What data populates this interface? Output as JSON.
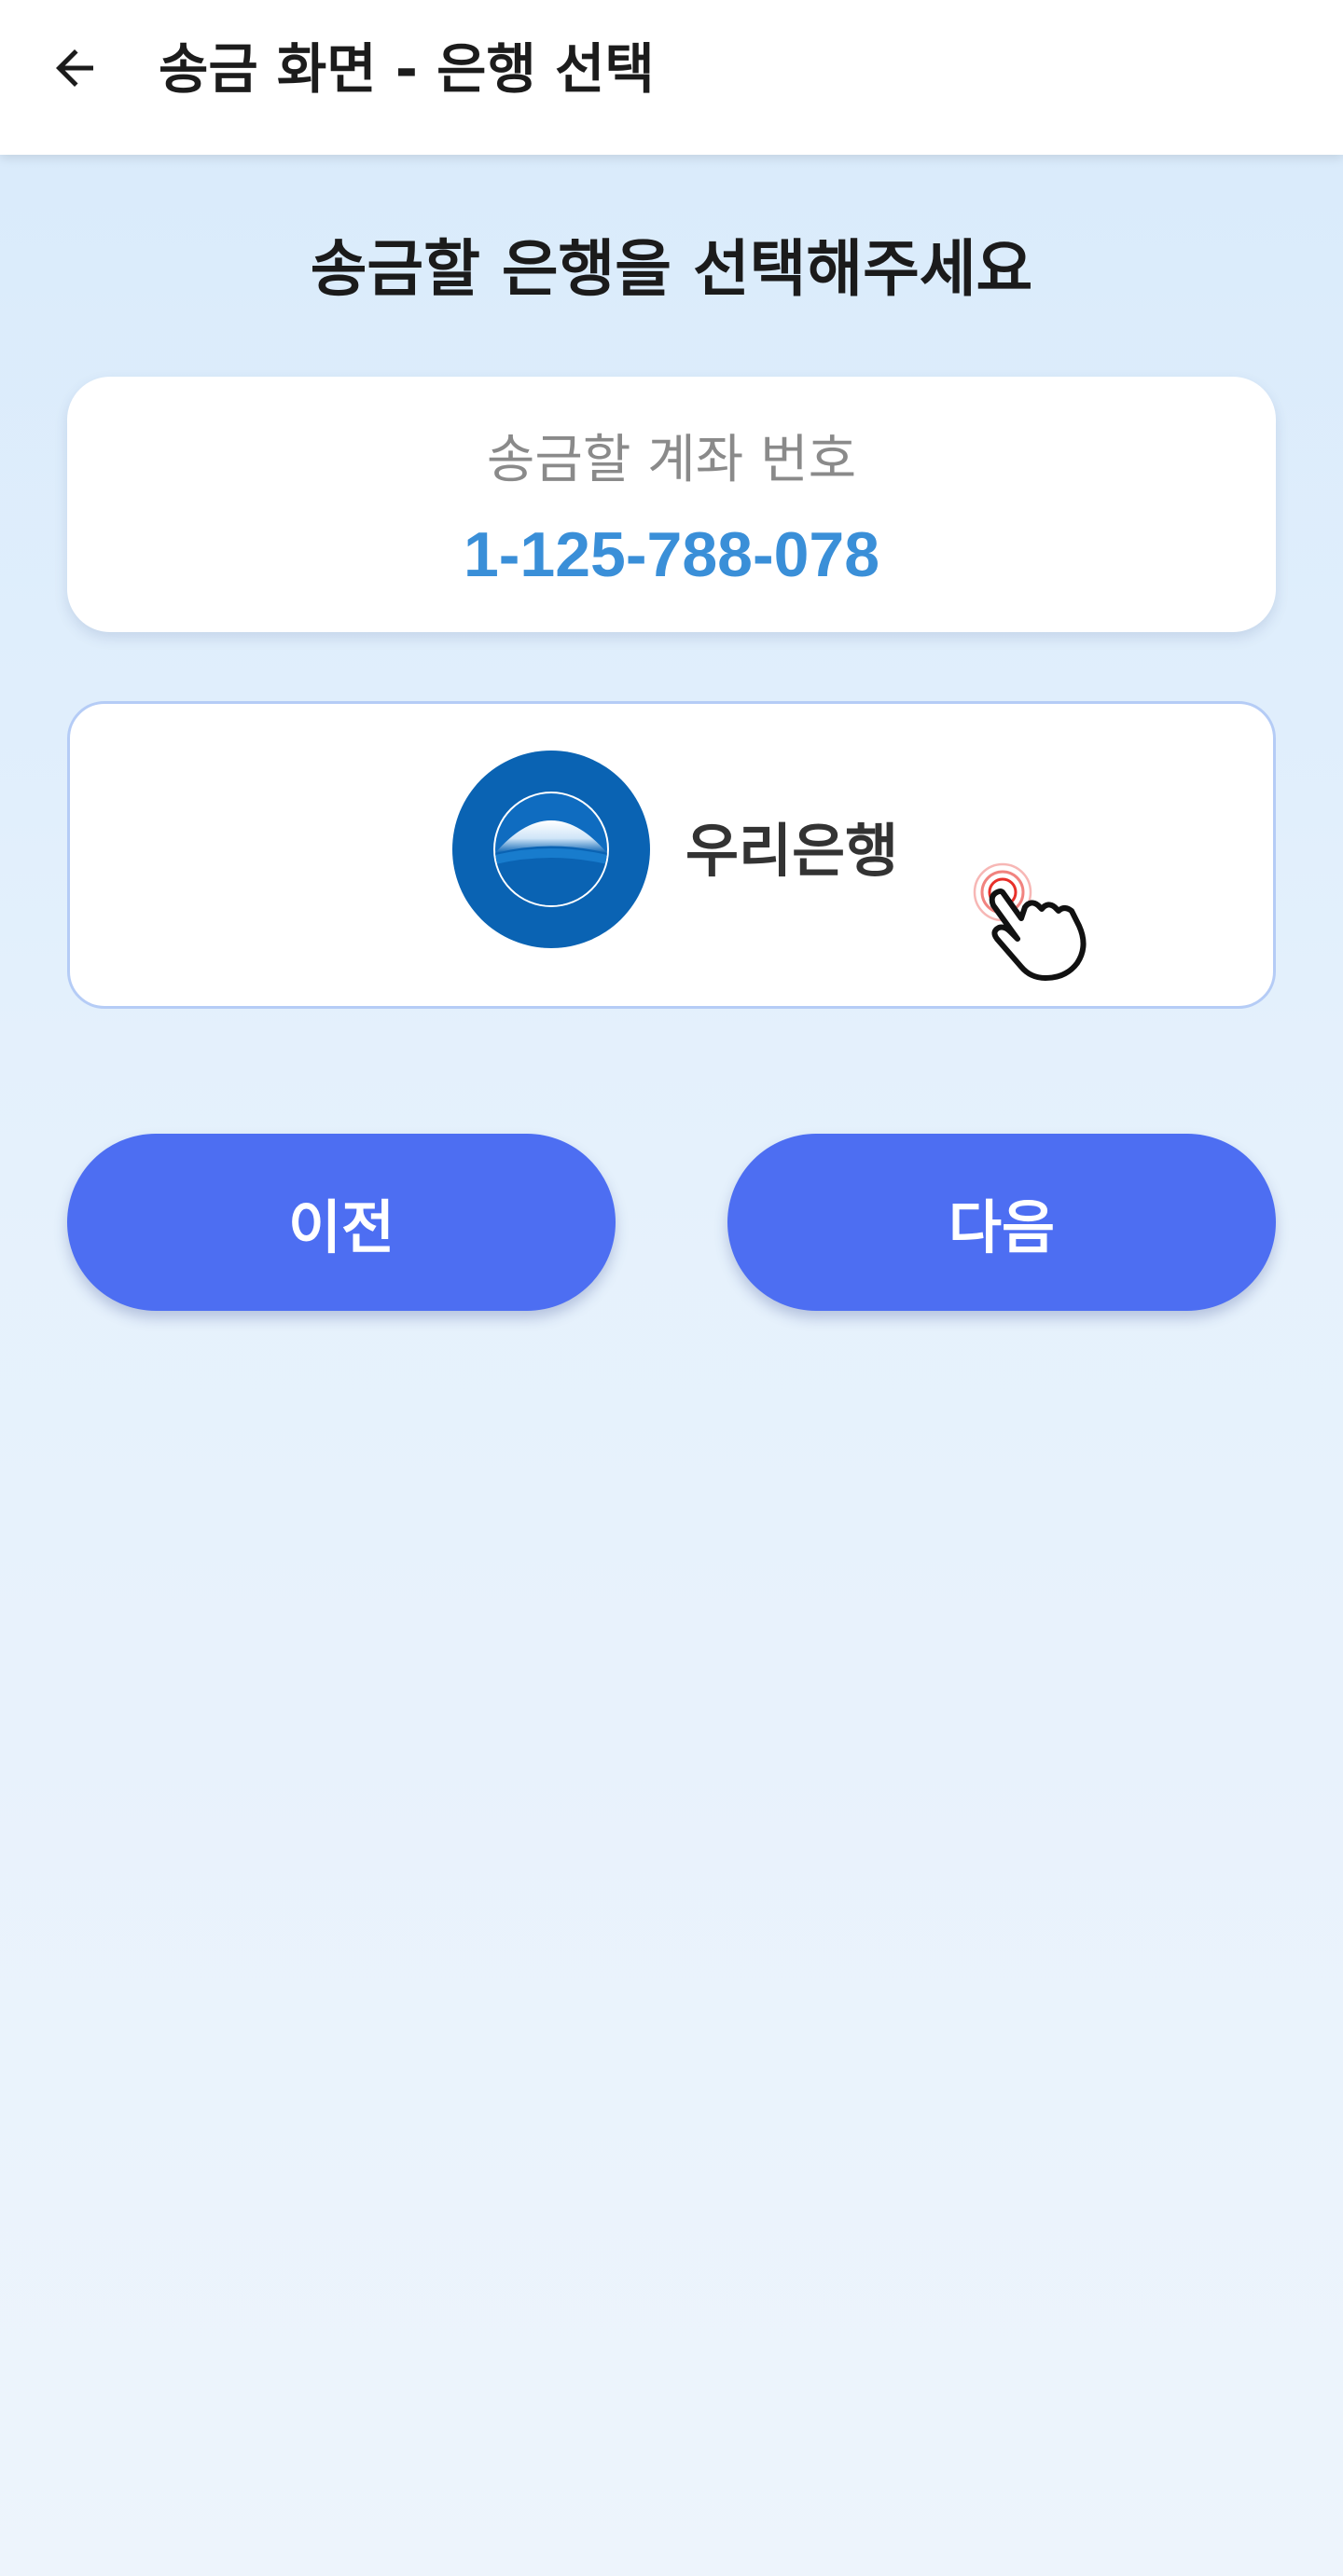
{
  "app_bar": {
    "back_icon": "arrow-left-icon",
    "title": "송금 화면 - 은행 선택"
  },
  "main": {
    "heading": "송금할 은행을 선택해주세요",
    "account": {
      "label": "송금할 계좌 번호",
      "number": "1-125-788-078"
    },
    "bank_option": {
      "logo_icon": "woori-bank-logo-icon",
      "name": "우리은행",
      "tap_indicator_icon": "tap-hand-cursor-icon"
    },
    "buttons": {
      "prev_label": "이전",
      "next_label": "다음"
    }
  },
  "colors": {
    "primary_button": "#4d6ef2",
    "account_number": "#3a8fd8",
    "bank_logo": "#0a63b3",
    "selected_border": "#b5ccf6"
  }
}
